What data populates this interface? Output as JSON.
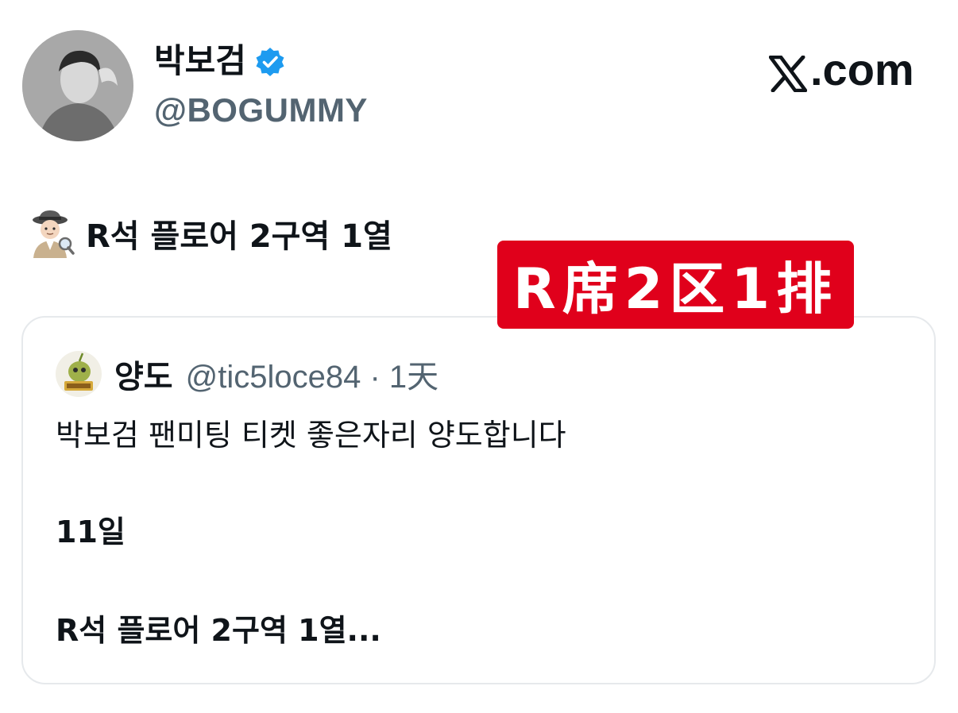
{
  "profile": {
    "display_name": "박보검",
    "handle": "@BOGUMMY",
    "verified_icon": "verified-badge-icon",
    "avatar": "profile-avatar"
  },
  "brand": {
    "text": ".com",
    "icon": "x-logo-icon"
  },
  "tweet": {
    "emoji_icon": "detective-emoji-icon",
    "text": "R석 플로어 2구역 1열"
  },
  "overlay": {
    "text": "R席2区1排",
    "color": "#e0001b"
  },
  "quote": {
    "name": "양도",
    "handle": "@tic5loce84 · 1天",
    "line1": "박보검 팬미팅 티켓 좋은자리 양도합니다",
    "line2": "11일",
    "line3": "R석 플로어 2구역 1열..."
  },
  "colors": {
    "secondary_text": "#536471",
    "verified": "#1d9bf0",
    "border": "#e6e9ec"
  }
}
